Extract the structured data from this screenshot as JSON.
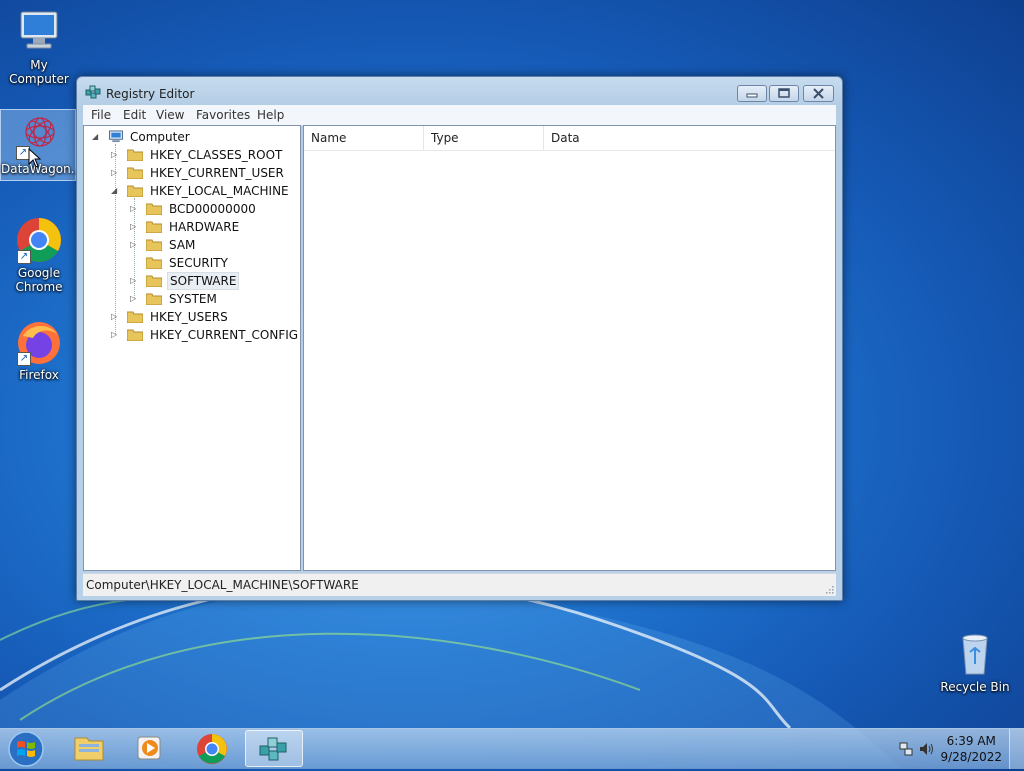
{
  "desktop": {
    "icons": [
      {
        "label": "My Computer"
      },
      {
        "label": "DataWagon..."
      },
      {
        "label": "Google Chrome"
      },
      {
        "label": "Firefox"
      },
      {
        "label": "Recycle Bin"
      }
    ]
  },
  "window": {
    "title": "Registry Editor",
    "menu": [
      "File",
      "Edit",
      "View",
      "Favorites",
      "Help"
    ],
    "tree": {
      "root": "Computer",
      "hives": [
        "HKEY_CLASSES_ROOT",
        "HKEY_CURRENT_USER",
        "HKEY_LOCAL_MACHINE",
        "HKEY_USERS",
        "HKEY_CURRENT_CONFIG"
      ],
      "hklm_children": [
        "BCD00000000",
        "HARDWARE",
        "SAM",
        "SECURITY",
        "SOFTWARE",
        "SYSTEM"
      ],
      "selected": "SOFTWARE"
    },
    "columns": [
      "Name",
      "Type",
      "Data"
    ],
    "status": "Computer\\HKEY_LOCAL_MACHINE\\SOFTWARE"
  },
  "taskbar": {
    "clock_time": "6:39 AM",
    "clock_date": "9/28/2022"
  },
  "colors": {
    "desktop_blue": "#1f74cf",
    "window_frame": "#b9d1e8",
    "folder_yellow": "#e8c55a"
  }
}
